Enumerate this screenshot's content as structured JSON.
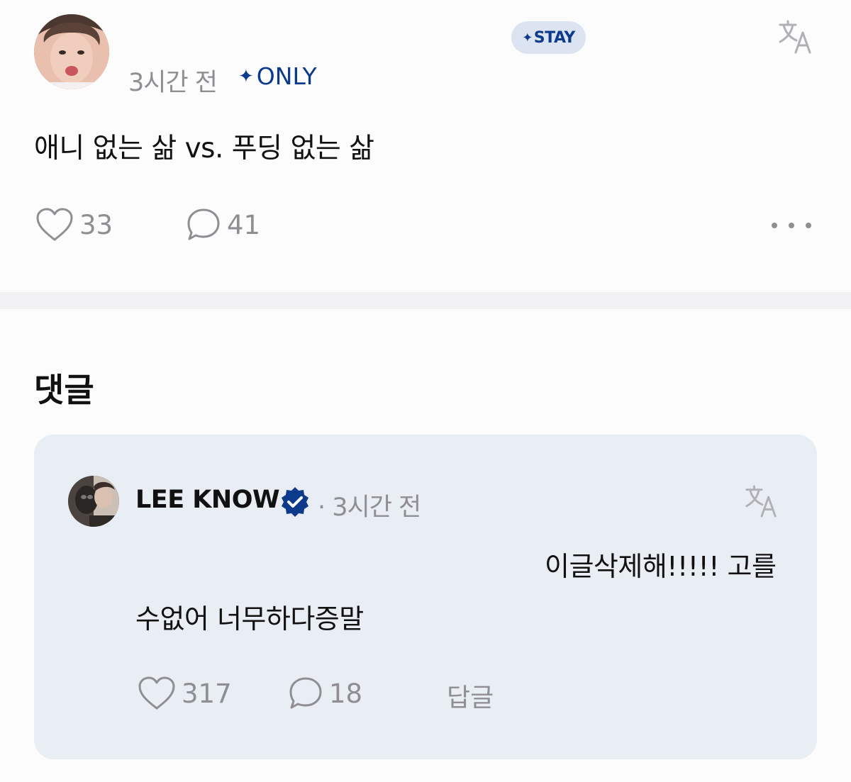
{
  "post": {
    "time": "3시간 전",
    "only_label": "ONLY",
    "only_star": "✦",
    "stay_label": "STAY",
    "stay_star": "✦",
    "body": "애니 없는 삶 vs. 푸딩 없는 삶",
    "likes": "33",
    "comments": "41",
    "icons": {
      "translate": "translate-icon",
      "like": "heart-icon",
      "comment": "speech-bubble-icon",
      "more": "more-dots-icon"
    }
  },
  "comments_section": {
    "title": "댓글",
    "items": [
      {
        "author": "LEE KNOW",
        "meta": "· 3시간 전",
        "text_line1": "이글삭제해!!!!! 고를",
        "text_line2": "수없어 너무하다증말",
        "likes": "317",
        "replies": "18",
        "reply_label": "답글"
      }
    ]
  },
  "colors": {
    "accent": "#0d3b8c",
    "muted": "#8e8e93",
    "card": "#e9edf4",
    "pill": "#dde4f1"
  }
}
